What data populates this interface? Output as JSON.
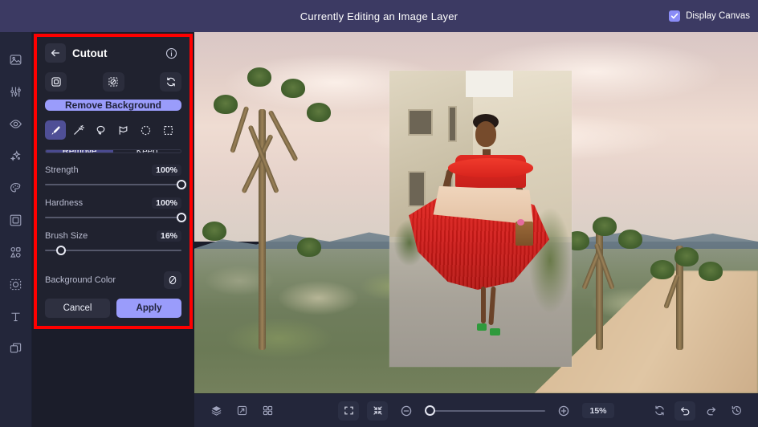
{
  "topbar": {
    "title": "Currently Editing an Image Layer",
    "display_canvas_label": "Display Canvas",
    "display_canvas_checked": true,
    "accent": "#8a8cf7",
    "background": "#3c3a63"
  },
  "rail": {
    "items": [
      {
        "name": "image-icon",
        "label": "Image"
      },
      {
        "name": "adjust-icon",
        "label": "Adjust"
      },
      {
        "name": "eye-icon",
        "label": "Effects"
      },
      {
        "name": "sparkle-icon",
        "label": "AI Tools"
      },
      {
        "name": "palette-icon",
        "label": "Color"
      },
      {
        "name": "frame-icon",
        "label": "Frame"
      },
      {
        "name": "shapes-icon",
        "label": "Elements"
      },
      {
        "name": "cutout-icon",
        "label": "Cutout"
      },
      {
        "name": "text-icon",
        "label": "Text"
      },
      {
        "name": "layers-icon",
        "label": "Layers"
      }
    ]
  },
  "panel": {
    "highlight_color": "#ff0000",
    "title": "Cutout",
    "back_label": "Back",
    "info_label": "Info",
    "mode_buttons": [
      {
        "name": "cutout-subject-icon",
        "label": "Subject"
      },
      {
        "name": "cutout-invert-icon",
        "label": "Invert"
      },
      {
        "name": "cutout-reset-icon",
        "label": "Reset"
      }
    ],
    "remove_background_label": "Remove Background",
    "tools": [
      {
        "name": "brush-tool-icon",
        "label": "Brush",
        "active": true
      },
      {
        "name": "magic-wand-tool-icon",
        "label": "Magic Wand",
        "active": false
      },
      {
        "name": "lasso-tool-icon",
        "label": "Lasso",
        "active": false
      },
      {
        "name": "polygon-lasso-tool-icon",
        "label": "Polygon Lasso",
        "active": false
      },
      {
        "name": "ellipse-select-icon",
        "label": "Ellipse",
        "active": false
      },
      {
        "name": "rect-select-icon",
        "label": "Rectangle",
        "active": false
      }
    ],
    "segment": {
      "remove_label": "Remove",
      "keep_label": "Keep",
      "selected": "Remove"
    },
    "sliders": [
      {
        "name": "strength",
        "label": "Strength",
        "value": "100%",
        "percent": 100
      },
      {
        "name": "hardness",
        "label": "Hardness",
        "value": "100%",
        "percent": 100
      },
      {
        "name": "brush-size",
        "label": "Brush Size",
        "value": "16%",
        "percent": 16
      }
    ],
    "background_color": {
      "label": "Background Color",
      "swatch_icon": "no-color-icon"
    },
    "cancel_label": "Cancel",
    "apply_label": "Apply",
    "accent": "#9a9cfb"
  },
  "bottombar": {
    "left": [
      {
        "name": "layers-panel-icon",
        "label": "Layers"
      },
      {
        "name": "transform-icon",
        "label": "Transform"
      },
      {
        "name": "grid-icon",
        "label": "Grid"
      }
    ],
    "center": [
      {
        "name": "fit-to-screen-icon",
        "label": "Fit to Screen"
      },
      {
        "name": "fill-screen-icon",
        "label": "Fill Screen"
      }
    ],
    "zoom_out_label": "Zoom Out",
    "zoom_in_label": "Zoom In",
    "zoom_percent": "15%",
    "zoom_slider_percent": 5,
    "right": [
      {
        "name": "refresh-icon",
        "label": "Refresh"
      },
      {
        "name": "undo-icon",
        "label": "Undo"
      },
      {
        "name": "redo-icon",
        "label": "Redo"
      },
      {
        "name": "history-icon",
        "label": "History"
      }
    ]
  },
  "canvas": {
    "background_photo_alt": "Desert landscape with joshua trees and mountains at dusk",
    "layer_image_alt": "Woman in red and cream pleated dress walking on a street"
  }
}
